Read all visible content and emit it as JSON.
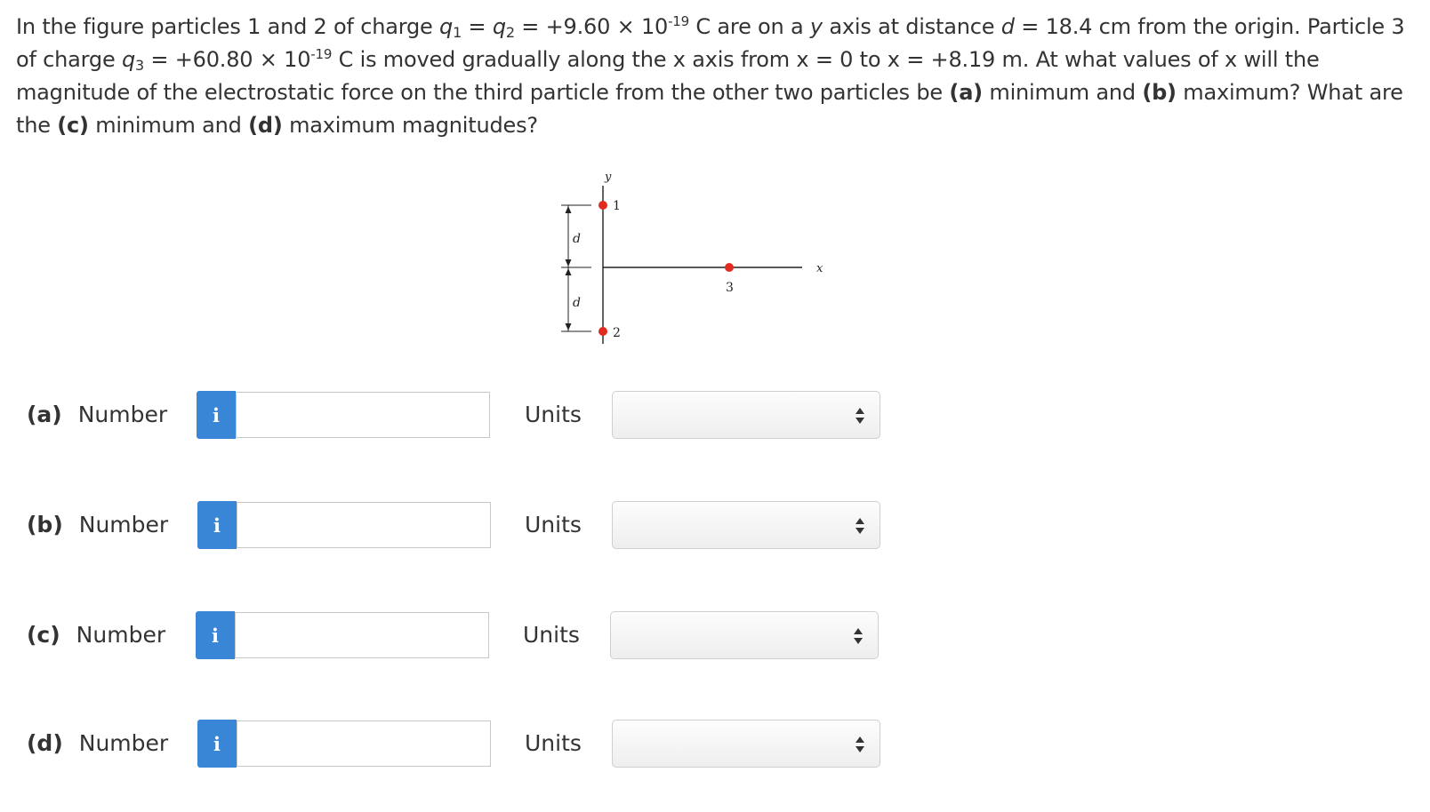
{
  "problem": {
    "p1": "In the figure particles 1 and 2 of charge ",
    "q1": "q",
    "q1_sub": "1",
    "p2": " = ",
    "q2": "q",
    "q2_sub": "2",
    "p3": " = +9.60 × 10",
    "exp1": "-19",
    "p4": " C are on a ",
    "yvar": "y",
    "p5": " axis at distance ",
    "dvar": "d",
    "p6": " = 18.4 cm from the origin. Particle 3 of charge ",
    "q3": "q",
    "q3_sub": "3",
    "p7": " = +60.80 × 10",
    "exp2": "-19",
    "p8": " C is moved gradually along the x axis from x = 0 to x = +8.19 m. At what values of x will the magnitude of the electrostatic force on the third particle from the other two particles be ",
    "a_tag": "(a)",
    "p9": " minimum and ",
    "b_tag": "(b)",
    "p10": " maximum? What are the ",
    "c_tag": "(c)",
    "p11": " minimum and ",
    "d_tag": "(d)",
    "p12": " maximum magnitudes?"
  },
  "figure": {
    "y_axis_label": "y",
    "x_axis_label": "x",
    "particle1_label": "1",
    "particle2_label": "2",
    "particle3_label": "3",
    "dist_label_top": "d",
    "dist_label_bottom": "d",
    "particle_color": "#e02b20"
  },
  "answers": [
    {
      "part": "(a)",
      "label": "Number",
      "info": "i",
      "value": "",
      "units_label": "Units",
      "units_value": ""
    },
    {
      "part": "(b)",
      "label": "Number",
      "info": "i",
      "value": "",
      "units_label": "Units",
      "units_value": ""
    },
    {
      "part": "(c)",
      "label": "Number",
      "info": "i",
      "value": "",
      "units_label": "Units",
      "units_value": ""
    },
    {
      "part": "(d)",
      "label": "Number",
      "info": "i",
      "value": "",
      "units_label": "Units",
      "units_value": ""
    }
  ],
  "colors": {
    "info_button": "#3a86d6",
    "text": "#333333"
  }
}
